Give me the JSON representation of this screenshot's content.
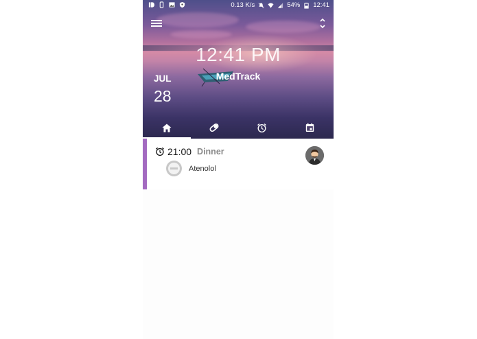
{
  "status_bar": {
    "network_speed": "0.13 K/s",
    "battery": "54%",
    "time": "12:41"
  },
  "header": {
    "big_time": "12:41 PM",
    "app_title": "MedTrack",
    "month": "JUL",
    "day": "28"
  },
  "tabs": [
    {
      "name": "home-icon",
      "active": true
    },
    {
      "name": "pill-icon",
      "active": false
    },
    {
      "name": "alarm-icon",
      "active": false
    },
    {
      "name": "calendar-icon",
      "active": false
    }
  ],
  "entry": {
    "time": "21:00",
    "meal": "Dinner",
    "medication": "Atenolol",
    "accent_color": "#a36ac0"
  }
}
